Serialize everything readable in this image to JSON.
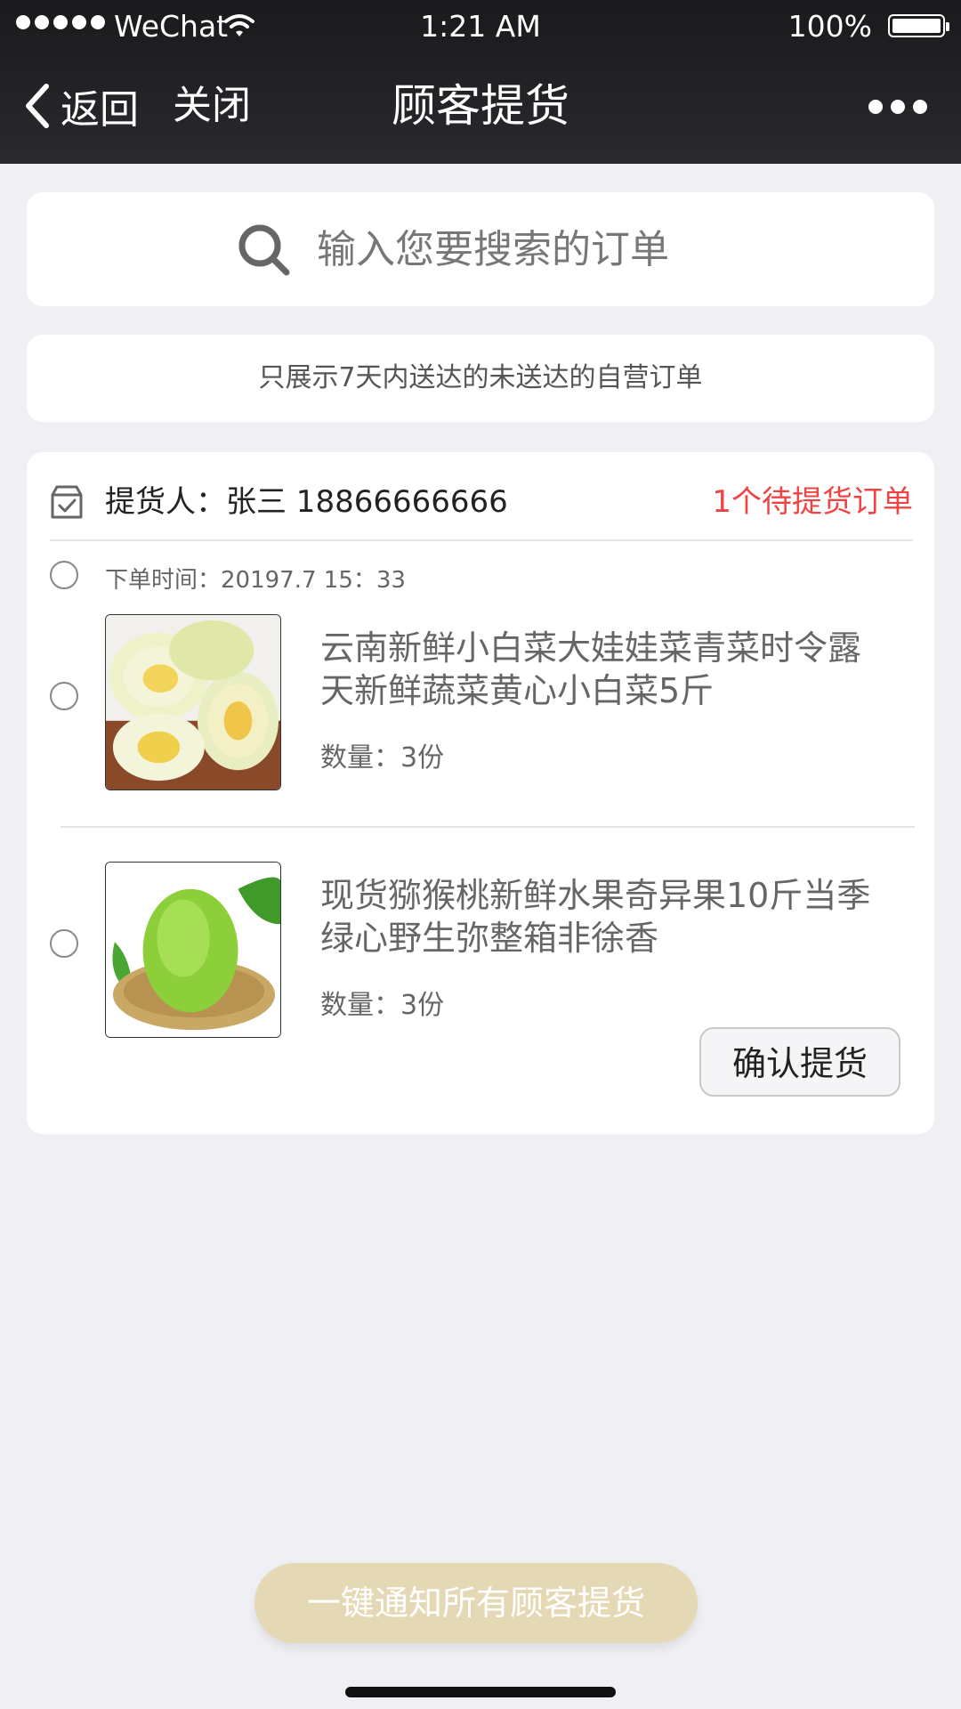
{
  "status_bar": {
    "carrier": "WeChat",
    "time": "1:21 AM",
    "battery": "100%",
    "battery_level": 1.0
  },
  "nav": {
    "back_label": "返回",
    "close_label": "关闭",
    "title": "顾客提货"
  },
  "search": {
    "placeholder": "输入您要搜索的订单"
  },
  "notice": "只展示7天内送达的未送达的自营订单",
  "order": {
    "pickup_person": "提货人：张三 18866666666",
    "pending_count": "1个待提货订单",
    "order_time": "下单时间：20197.7 15：33",
    "items": [
      {
        "title": "云南新鲜小白菜大娃娃菜青菜时令露天新鲜蔬菜黄心小白菜5斤",
        "quantity": "数量：3份",
        "thumb_icon": "cabbage-image"
      },
      {
        "title": "现货猕猴桃新鲜水果奇异果10斤当季绿心野生弥整箱非徐香",
        "quantity": "数量：3份",
        "thumb_icon": "kiwi-image"
      }
    ],
    "confirm_label": "确认提货"
  },
  "notify_all_label": "一键通知所有顾客提货",
  "colors": {
    "header_bg": "#1f1f22",
    "page_bg": "#efeff4",
    "pending_red": "#f04444",
    "notify_button_bg": "#e5d8b5"
  }
}
